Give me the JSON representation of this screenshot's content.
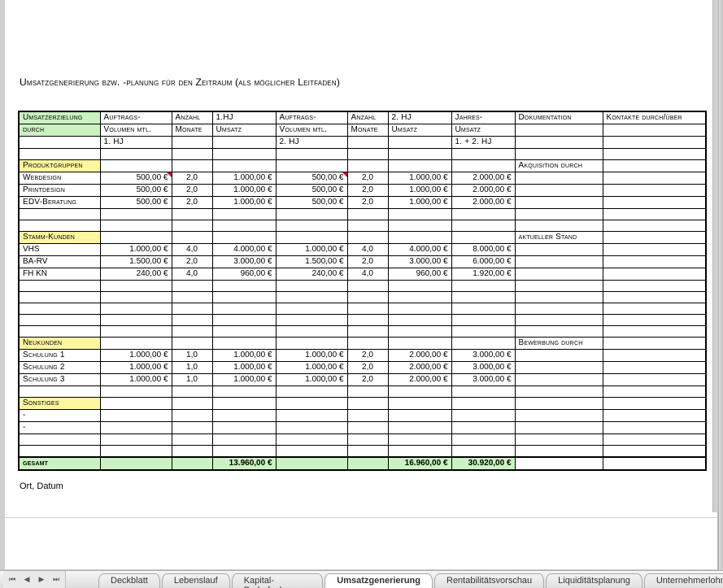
{
  "title": "Umsatzgenerierung bzw. -planung für den Zeitraum (als möglicher Leitfaden)",
  "place_date": "Ort, Datum",
  "headers": {
    "c0_a": "Umsatzerzielung",
    "c0_b": "durch",
    "c1_a": "Auftrags-",
    "c1_b": "Volumen mtl.",
    "c1_c": "1. HJ",
    "c2_a": "Anzahl",
    "c2_b": "Monate",
    "c3_a": "1.HJ",
    "c3_b": "Umsatz",
    "c4_a": "Auftrags-",
    "c4_b": "Volumen mtl.",
    "c4_c": "2. HJ",
    "c5_a": "Anzahl",
    "c5_b": "Monate",
    "c6_a": "2. HJ",
    "c6_b": "Umsatz",
    "c7_a": "Jahres-",
    "c7_b": "Umsatz",
    "c7_c": "1. + 2. HJ",
    "c8_a": "Dokumentation",
    "c9_a": "Kontakte durch/über"
  },
  "sections": {
    "produktgruppen": {
      "label": "Produktgruppen",
      "doc": "Akquisition durch"
    },
    "stammkunden": {
      "label": "Stamm-Kunden",
      "doc": "aktueller Stand"
    },
    "neukunden": {
      "label": "Neukunden",
      "doc": "Bewerbung durch"
    },
    "sonstiges": {
      "label": "Sonstiges"
    },
    "gesamt": {
      "label": "gesamt"
    },
    "dash": "-"
  },
  "rows": {
    "webdesign": {
      "name": "Webdesign",
      "v1": "500,00 €",
      "m1": "2,0",
      "u1": "1.000,00 €",
      "v2": "500,00 €",
      "m2": "2,0",
      "u2": "1.000,00 €",
      "uj": "2.000,00 €"
    },
    "printdesign": {
      "name": "Printdesign",
      "v1": "500,00 €",
      "m1": "2,0",
      "u1": "1.000,00 €",
      "v2": "500,00 €",
      "m2": "2,0",
      "u2": "1.000,00 €",
      "uj": "2.000,00 €"
    },
    "edvberatung": {
      "name": "EDV-Beratung",
      "v1": "500,00 €",
      "m1": "2,0",
      "u1": "1.000,00 €",
      "v2": "500,00 €",
      "m2": "2,0",
      "u2": "1.000,00 €",
      "uj": "2.000,00 €"
    },
    "vhs": {
      "name": "VHS",
      "v1": "1.000,00 €",
      "m1": "4,0",
      "u1": "4.000,00 €",
      "v2": "1.000,00 €",
      "m2": "4,0",
      "u2": "4.000,00 €",
      "uj": "8.000,00 €"
    },
    "barv": {
      "name": "BA-RV",
      "v1": "1.500,00 €",
      "m1": "2,0",
      "u1": "3.000,00 €",
      "v2": "1.500,00 €",
      "m2": "2,0",
      "u2": "3.000,00 €",
      "uj": "6.000,00 €"
    },
    "fhkn": {
      "name": "FH KN",
      "v1": "240,00 €",
      "m1": "4,0",
      "u1": "960,00 €",
      "v2": "240,00 €",
      "m2": "4,0",
      "u2": "960,00 €",
      "uj": "1.920,00 €"
    },
    "sch1": {
      "name": "Schulung 1",
      "v1": "1.000,00 €",
      "m1": "1,0",
      "u1": "1.000,00 €",
      "v2": "1.000,00 €",
      "m2": "2,0",
      "u2": "2.000,00 €",
      "uj": "3.000,00 €"
    },
    "sch2": {
      "name": "Schulung 2",
      "v1": "1.000,00 €",
      "m1": "1,0",
      "u1": "1.000,00 €",
      "v2": "1.000,00 €",
      "m2": "2,0",
      "u2": "2.000,00 €",
      "uj": "3.000,00 €"
    },
    "sch3": {
      "name": "Schulung 3",
      "v1": "1.000,00 €",
      "m1": "1,0",
      "u1": "1.000,00 €",
      "v2": "1.000,00 €",
      "m2": "2,0",
      "u2": "2.000,00 €",
      "uj": "3.000,00 €"
    }
  },
  "totals": {
    "u1": "13.960,00 €",
    "u2": "16.960,00 €",
    "uj": "30.920,00 €"
  },
  "tabs": {
    "deckblatt": "Deckblatt",
    "lebenslauf": "Lebenslauf",
    "kapital": "Kapital-Bedarfsplanung",
    "umsatz": "Umsatzgenerierung",
    "rentab": "Rentabilitätsvorschau",
    "liquid": "Liquiditätsplanung",
    "unternehmerlohn": "Unternehmerlohn",
    "add": "+"
  },
  "nav": {
    "first": "⏮",
    "prev": "◀",
    "next": "▶",
    "last": "⏭"
  }
}
